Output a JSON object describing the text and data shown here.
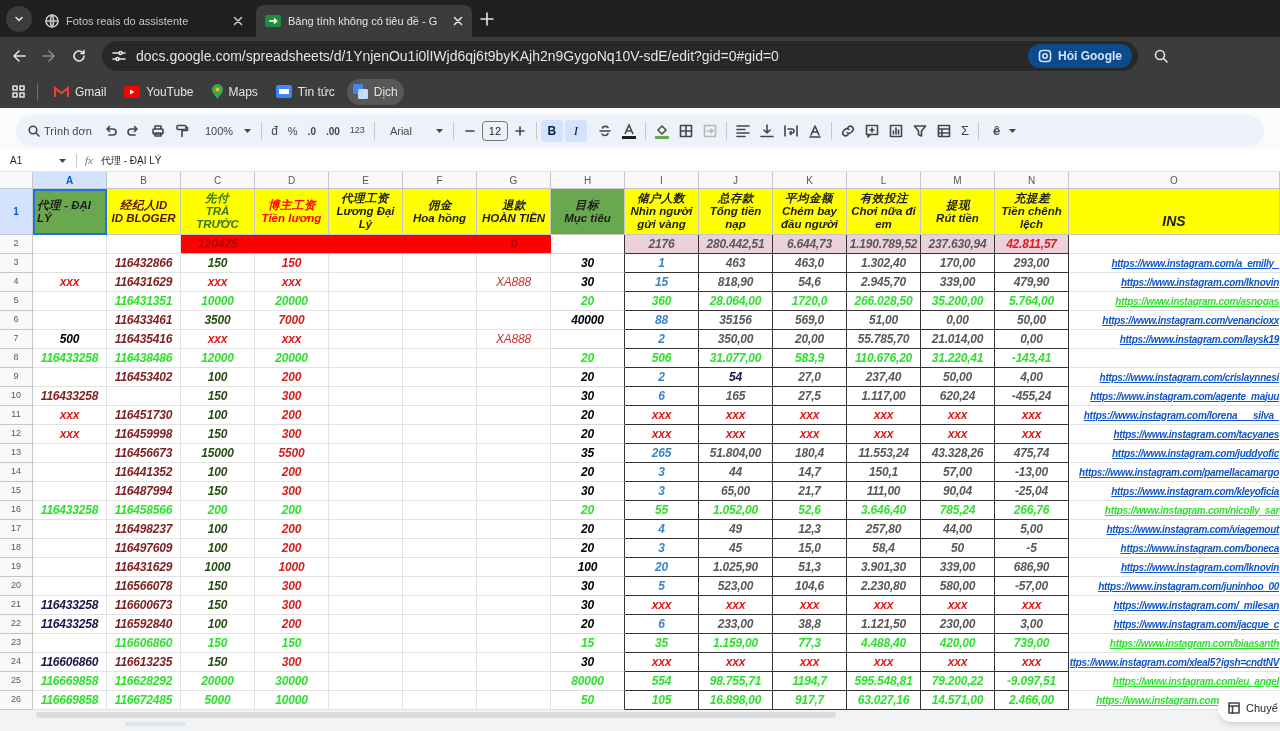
{
  "browser": {
    "tabs": [
      {
        "title": "Fotos reais do assistente",
        "selected": false
      },
      {
        "title": "Bảng tính không có tiêu đề - G",
        "selected": true
      }
    ],
    "address": "docs.google.com/spreadsheets/d/1YnjenOu1i0lIWjd6qj6t9byKAjh2n9GygoNq10V-sdE/edit?gid=0#gid=0",
    "ask_button": "Hỏi Google",
    "bookmarks": [
      {
        "label": "Gmail",
        "hovered": false
      },
      {
        "label": "YouTube",
        "hovered": false
      },
      {
        "label": "Maps",
        "hovered": false
      },
      {
        "label": "Tin tức",
        "hovered": false
      },
      {
        "label": "Dịch",
        "hovered": true
      }
    ]
  },
  "toolbar": {
    "search": "Trình đơn",
    "zoom": "100%",
    "currency": "đ",
    "percent": "%",
    "decrease_decimals": ".0",
    "increase_decimals": ".00",
    "number_format": "123",
    "font": "Arial",
    "font_size": "12",
    "bold": {
      "label": "B",
      "on": true
    },
    "italic": {
      "label": "I",
      "on": true
    },
    "sum": "Σ",
    "input_tools": "ê"
  },
  "formula_bar": {
    "name_box": "A1",
    "fx": "fx",
    "formula": "代理 - ĐẠI LÝ"
  },
  "columns": [
    {
      "label": "A",
      "selected": true
    },
    {
      "label": "B",
      "selected": false
    },
    {
      "label": "C",
      "selected": false
    },
    {
      "label": "D",
      "selected": false
    },
    {
      "label": "E",
      "selected": false
    },
    {
      "label": "F",
      "selected": false
    },
    {
      "label": "G",
      "selected": false
    },
    {
      "label": "H",
      "selected": false
    },
    {
      "label": "I",
      "selected": false
    },
    {
      "label": "J",
      "selected": false
    },
    {
      "label": "K",
      "selected": false
    },
    {
      "label": "L",
      "selected": false
    },
    {
      "label": "M",
      "selected": false
    },
    {
      "label": "N",
      "selected": false
    },
    {
      "label": "O",
      "selected": false
    }
  ],
  "header_row": {
    "number": "1",
    "selected": true,
    "cells": [
      {
        "text": "代理 - ĐẠI LÝ",
        "kind": "green"
      },
      {
        "text": "经纪人ID\nID BLOGER",
        "kind": "yellow"
      },
      {
        "text": "先付\nTRẢ\nTRƯỚC",
        "kind": "yellow"
      },
      {
        "text": "博主工资\nTiền lương",
        "kind": "yellow"
      },
      {
        "text": "代理工资\nLương Đại\nLý",
        "kind": "yellow"
      },
      {
        "text": "佣金\nHoa hồng",
        "kind": "yellow"
      },
      {
        "text": "退款\nHOÀN TIỀN",
        "kind": "yellow"
      },
      {
        "text": "目标\nMục tiêu",
        "kind": "green"
      },
      {
        "text": "储户人数\nNhìn người\ngửi vàng",
        "kind": "yellow"
      },
      {
        "text": "总存款\nTổng tiền\nnạp",
        "kind": "yellow"
      },
      {
        "text": "平均金额\nChém bay\nđầu người",
        "kind": "yellow"
      },
      {
        "text": "有效投注\nChơi nữa đi\nem",
        "kind": "yellow"
      },
      {
        "text": "提现\nRút tiền",
        "kind": "yellow"
      },
      {
        "text": "充提差\nTiền chênh\nlệch",
        "kind": "yellow"
      },
      {
        "text": "INS",
        "kind": "yellow"
      }
    ]
  },
  "rows": [
    {
      "number": "2",
      "kind": "summary",
      "C": "120425",
      "G": "0",
      "I": "2176",
      "J": "280.442,51",
      "K": "6.644,73",
      "L": "1.190.789,52",
      "M": "237.630,94",
      "N": {
        "text": "42.811,57",
        "kind": "alert"
      }
    },
    {
      "number": "3",
      "kind": "plain",
      "B": "116432866",
      "C": "150",
      "D": "150",
      "H": "30",
      "I": "1",
      "J": "463",
      "K": "463,0",
      "L": "1.302,40",
      "M": "170,00",
      "N": "293,00",
      "O": "https://www.instagram.com/a_emilly_"
    },
    {
      "number": "4",
      "kind": "plain",
      "A": {
        "text": "xxx",
        "kind": "alert"
      },
      "B": "116431629",
      "C": {
        "text": "xxx",
        "kind": "alert"
      },
      "D": {
        "text": "xxx",
        "kind": "alert"
      },
      "G": "XA888",
      "H": "30",
      "I": "15",
      "J": "818,90",
      "K": "54,6",
      "L": "2.945,70",
      "M": "339,00",
      "N": "479,90",
      "O": "https://www.instagram.com/lknovin"
    },
    {
      "number": "5",
      "kind": "highlight",
      "B": "116431351",
      "C": "10000",
      "D": "20000",
      "H": "20",
      "I": "360",
      "J": "28.064,00",
      "K": "1720,0",
      "L": "266.028,50",
      "M": "35.200,00",
      "N": "5.764,00",
      "O": "https://www.instagram.com/asnogas"
    },
    {
      "number": "6",
      "kind": "plain",
      "B": "116433461",
      "C": "3500",
      "D": "7000",
      "H": "40000",
      "I": "88",
      "J": "35156",
      "K": "569,0",
      "L": "51,00",
      "M": "0,00",
      "N": "50,00",
      "O": "https://www.instagram.com/venancioxx"
    },
    {
      "number": "7",
      "kind": "plain",
      "A": {
        "text": "500",
        "kind": "plain"
      },
      "B": "116435416",
      "C": {
        "text": "xxx",
        "kind": "alert"
      },
      "D": {
        "text": "xxx",
        "kind": "alert"
      },
      "G": "XA888",
      "I": "2",
      "J": "350,00",
      "K": "20,00",
      "L": "55.785,70",
      "M": "21.014,00",
      "N": "0,00",
      "O": "https://www.instagram.com/laysk19"
    },
    {
      "number": "8",
      "kind": "highlight",
      "A": "116433258",
      "B": "116438486",
      "C": "12000",
      "D": "20000",
      "H": "20",
      "I": "506",
      "J": "31.077,00",
      "K": "583,9",
      "L": "110.676,20",
      "M": "31.220,41",
      "N": "-143,41"
    },
    {
      "number": "9",
      "kind": "plain",
      "B": "116453402",
      "C": "100",
      "D": "200",
      "H": "20",
      "I": "2",
      "J": {
        "text": "54",
        "kind": "agent"
      },
      "K": "27,0",
      "L": "237,40",
      "M": "50,00",
      "N": "4,00",
      "O": "https://www.instagram.com/crislaynnesi"
    },
    {
      "number": "10",
      "kind": "plain",
      "A": "116433258",
      "C": "150",
      "D": "300",
      "H": "30",
      "I": "6",
      "J": "165",
      "K": "27,5",
      "L": "1.117,00",
      "M": "620,24",
      "N": "-455,24",
      "O": "https://www.instagram.com/agente_majuu"
    },
    {
      "number": "11",
      "kind": "plain",
      "A": {
        "text": "xxx",
        "kind": "alert"
      },
      "B": "116451730",
      "C": "100",
      "D": "200",
      "H": "20",
      "I": {
        "text": "xxx",
        "kind": "alert"
      },
      "J": {
        "text": "xxx",
        "kind": "alert"
      },
      "K": {
        "text": "xxx",
        "kind": "alert"
      },
      "L": {
        "text": "xxx",
        "kind": "alert"
      },
      "M": {
        "text": "xxx",
        "kind": "alert"
      },
      "N": {
        "text": "xxx",
        "kind": "alert"
      },
      "O": "https://www.instagram.com/lorena___silva_"
    },
    {
      "number": "12",
      "kind": "plain",
      "A": {
        "text": "xxx",
        "kind": "alert"
      },
      "B": "116459998",
      "C": "150",
      "D": "300",
      "H": "20",
      "I": {
        "text": "xxx",
        "kind": "alert"
      },
      "J": {
        "text": "xxx",
        "kind": "alert"
      },
      "K": {
        "text": "xxx",
        "kind": "alert"
      },
      "L": {
        "text": "xxx",
        "kind": "alert"
      },
      "M": {
        "text": "xxx",
        "kind": "alert"
      },
      "N": {
        "text": "xxx",
        "kind": "alert"
      },
      "O": "https://www.instagram.com/tacyanes"
    },
    {
      "number": "13",
      "kind": "plain",
      "B": "116456673",
      "C": "15000",
      "D": "5500",
      "H": "35",
      "I": "265",
      "J": "51.804,00",
      "K": "180,4",
      "L": "11.553,24",
      "M": "43.328,26",
      "N": "475,74",
      "O": "https://www.instagram.com/juddyofic"
    },
    {
      "number": "14",
      "kind": "plain",
      "B": "116441352",
      "C": "100",
      "D": "200",
      "H": "20",
      "I": "3",
      "J": "44",
      "K": "14,7",
      "L": "150,1",
      "M": "57,00",
      "N": "-13,00",
      "O": "https://www.instagram.com/pamellacamargo"
    },
    {
      "number": "15",
      "kind": "plain",
      "B": "116487994",
      "C": "150",
      "D": "300",
      "H": "30",
      "I": "3",
      "J": "65,00",
      "K": "21,7",
      "L": "111,00",
      "M": "90,04",
      "N": "-25,04",
      "O": "https://www.instagram.com/kleyoficia"
    },
    {
      "number": "16",
      "kind": "highlight",
      "A": "116433258",
      "B": "116458566",
      "C": "200",
      "D": "200",
      "H": "20",
      "I": "55",
      "J": "1.052,00",
      "K": "52,6",
      "L": "3.646,40",
      "M": "785,24",
      "N": "266,76",
      "O": "https://www.instagram.com/nicolly_sar"
    },
    {
      "number": "17",
      "kind": "plain",
      "B": "116498237",
      "C": "100",
      "D": "200",
      "H": "20",
      "I": "4",
      "J": "49",
      "K": "12,3",
      "L": "257,80",
      "M": "44,00",
      "N": "5,00",
      "O": "https://www.instagram.com/viagemout"
    },
    {
      "number": "18",
      "kind": "plain",
      "B": "116497609",
      "C": "100",
      "D": "200",
      "H": "20",
      "I": "3",
      "J": "45",
      "K": "15,0",
      "L": "58,4",
      "M": "50",
      "N": "-5",
      "O": "https://www.instagram.com/boneca"
    },
    {
      "number": "19",
      "kind": "plain",
      "B": "116431629",
      "C": "1000",
      "D": "1000",
      "H": "100",
      "I": "20",
      "J": "1.025,90",
      "K": "51,3",
      "L": "3.901,30",
      "M": "339,00",
      "N": "686,90",
      "O": "https://www.instagram.com/lknovin"
    },
    {
      "number": "20",
      "kind": "plain",
      "B": "116566078",
      "C": "150",
      "D": "300",
      "H": "30",
      "I": "5",
      "J": "523,00",
      "K": "104,6",
      "L": "2.230,80",
      "M": "580,00",
      "N": "-57,00",
      "O": "https://www.instagram.com/juninhoo_00"
    },
    {
      "number": "21",
      "kind": "plain",
      "A": {
        "text": "116433258",
        "kind": "agent"
      },
      "B": "116600673",
      "C": "150",
      "D": "300",
      "H": "30",
      "I": {
        "text": "xxx",
        "kind": "alert"
      },
      "J": {
        "text": "xxx",
        "kind": "alert"
      },
      "K": {
        "text": "xxx",
        "kind": "alert"
      },
      "L": {
        "text": "xxx",
        "kind": "alert"
      },
      "M": {
        "text": "xxx",
        "kind": "alert"
      },
      "N": {
        "text": "xxx",
        "kind": "alert"
      },
      "O": "https://www.instagram.com/_milesan"
    },
    {
      "number": "22",
      "kind": "plain",
      "A": {
        "text": "116433258",
        "kind": "agent"
      },
      "B": "116592840",
      "C": "100",
      "D": "200",
      "H": "20",
      "I": "6",
      "J": "233,00",
      "K": "38,8",
      "L": "1.121,50",
      "M": "230,00",
      "N": "3,00",
      "O": "https://www.instagram.com/jacque_c"
    },
    {
      "number": "23",
      "kind": "highlight",
      "B": "116606860",
      "C": "150",
      "D": "150",
      "H": "15",
      "I": "35",
      "J": "1.159,00",
      "K": "77,3",
      "L": "4.488,40",
      "M": "420,00",
      "N": "739,00",
      "O": "https://www.instagram.com/biaasanth"
    },
    {
      "number": "24",
      "kind": "plain",
      "A": {
        "text": "116606860",
        "kind": "agent"
      },
      "B": "116613235",
      "C": "150",
      "D": "300",
      "H": "30",
      "I": {
        "text": "xxx",
        "kind": "alert"
      },
      "J": {
        "text": "xxx",
        "kind": "alert"
      },
      "K": {
        "text": "xxx",
        "kind": "alert"
      },
      "L": {
        "text": "xxx",
        "kind": "alert"
      },
      "M": {
        "text": "xxx",
        "kind": "alert"
      },
      "N": {
        "text": "xxx",
        "kind": "alert"
      },
      "O": "ttps://www.instagram.com/xleal5?igsh=cndtNV"
    },
    {
      "number": "25",
      "kind": "highlight",
      "A": "116669858",
      "B": "116628292",
      "C": "20000",
      "D": "30000",
      "H": "80000",
      "I": "554",
      "J": "98.755,71",
      "K": "1194,7",
      "L": "595.548,81",
      "M": "79.200,22",
      "N": "-9.097,51",
      "O": "https://www.instagram.com/eu_angel"
    },
    {
      "number": "26",
      "kind": "highlight",
      "A": "116669858",
      "B": "116672485",
      "C": "5000",
      "D": "10000",
      "H": "50",
      "I": "105",
      "J": "16.898,00",
      "K": "917,7",
      "L": "63.027,16",
      "M": "14.571,00",
      "N": "2.466,00",
      "O": {
        "text": "https://www.instagram.com",
        "kind": "covered"
      }
    }
  ],
  "floating_chip": "Chuyể"
}
